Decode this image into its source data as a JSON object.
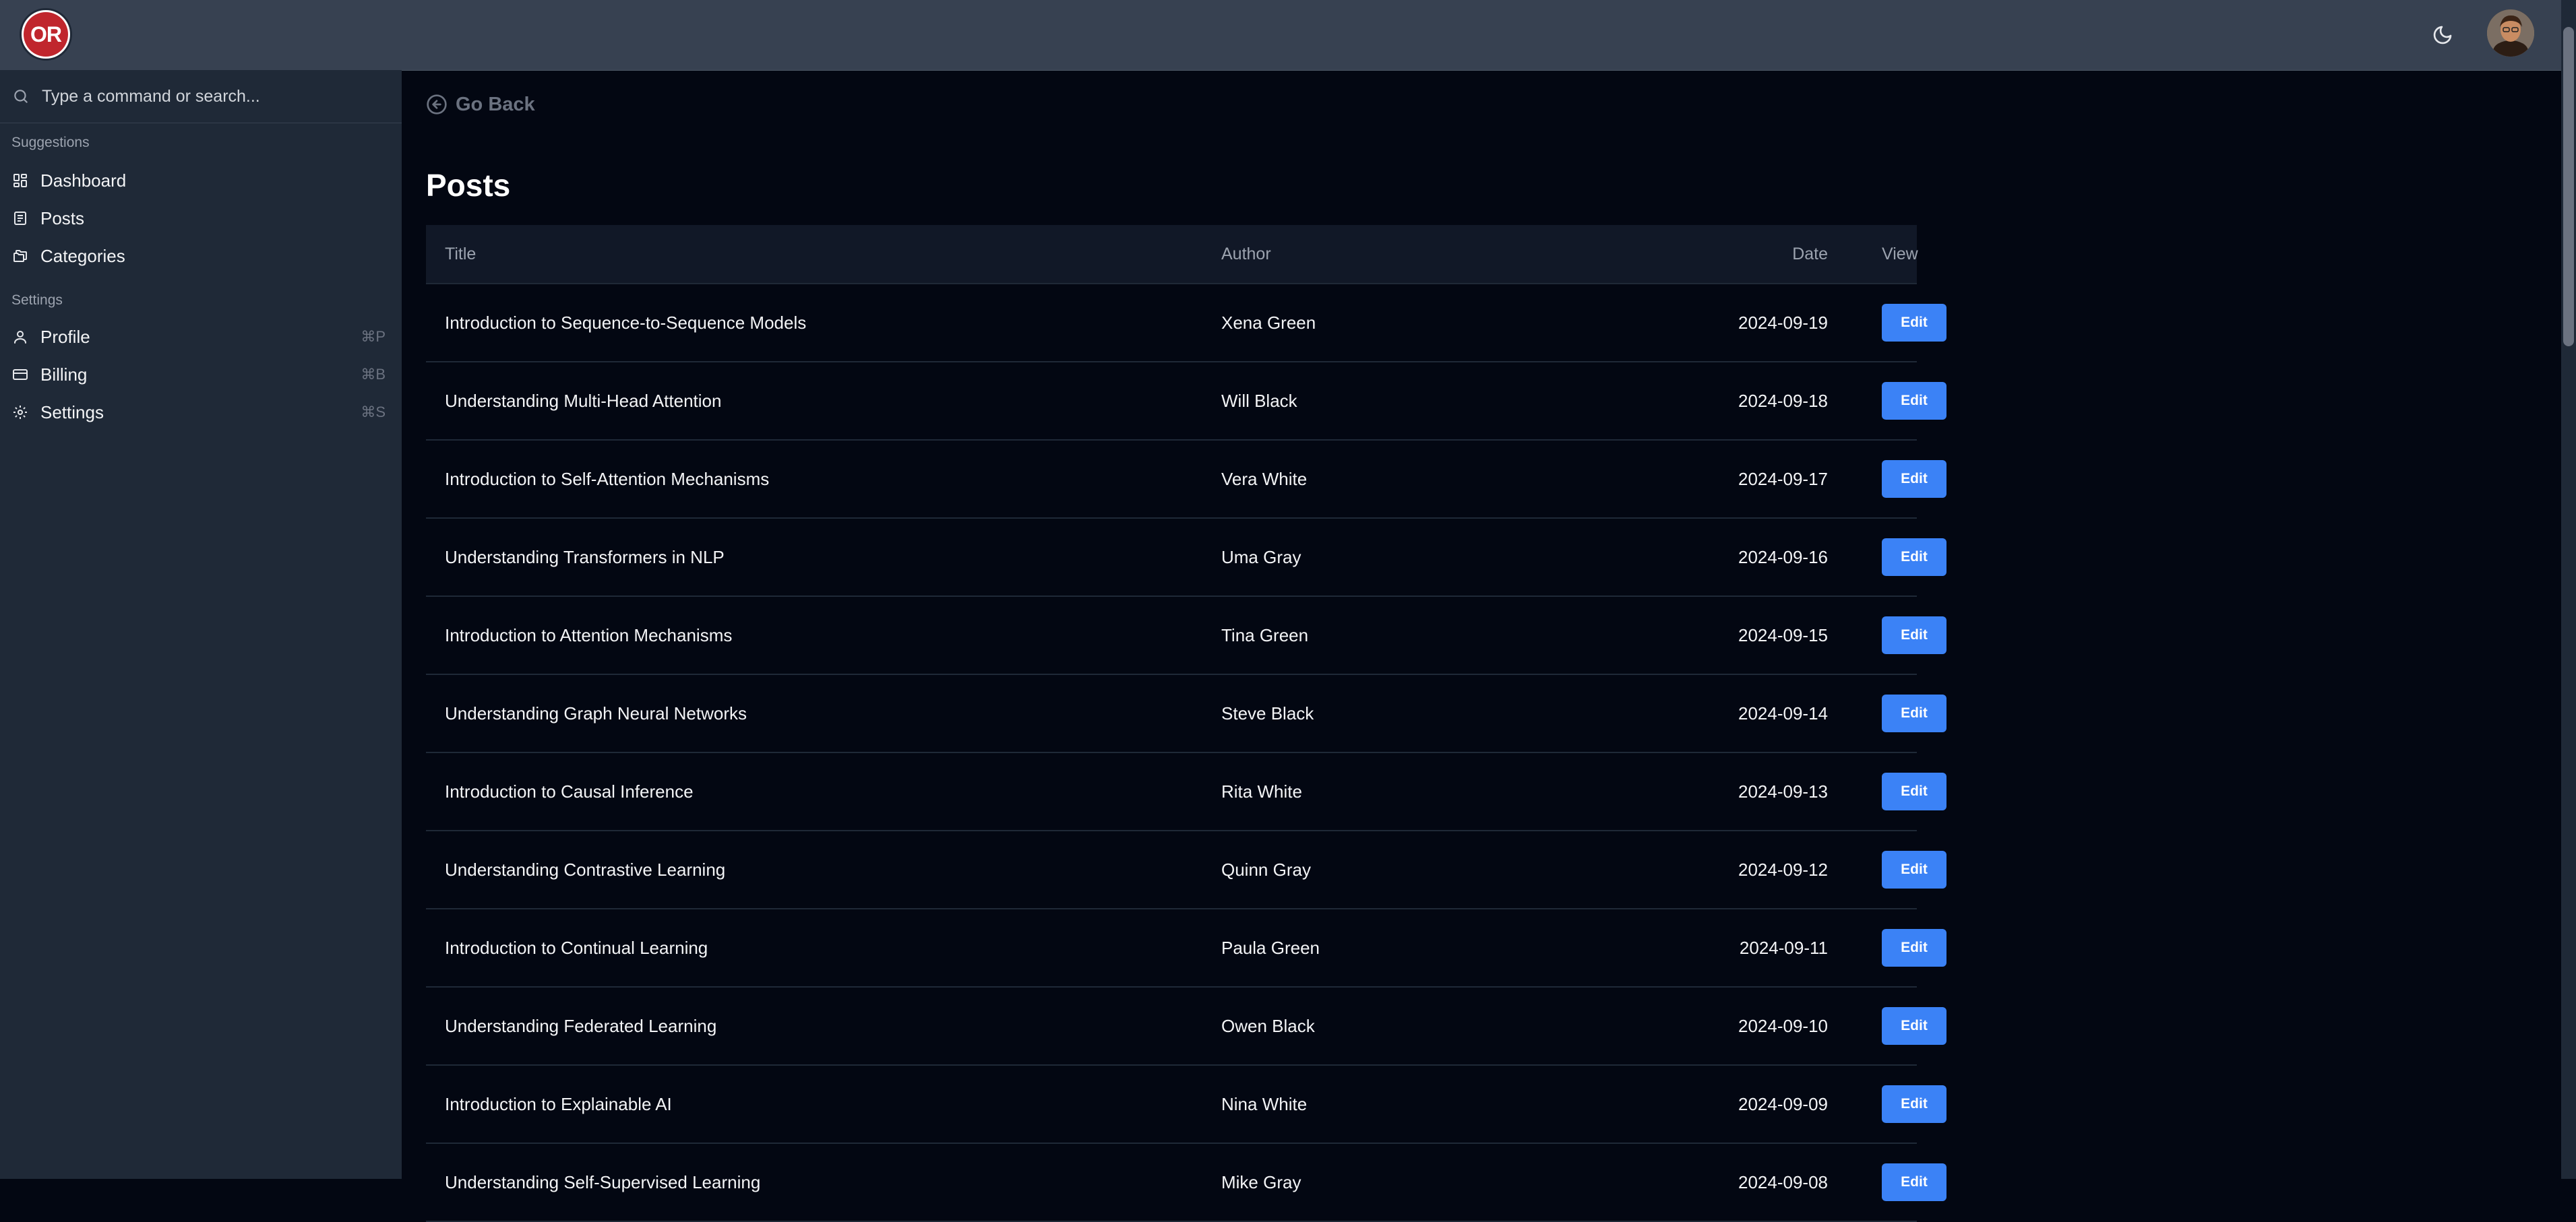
{
  "header": {
    "logo_text": "OR",
    "theme_icon": "moon-icon",
    "avatar_icon": "user-avatar"
  },
  "sidebar": {
    "search_placeholder": "Type a command or search...",
    "groups": [
      {
        "label": "Suggestions",
        "items": [
          {
            "label": "Dashboard",
            "icon": "dashboard-icon",
            "shortcut": ""
          },
          {
            "label": "Posts",
            "icon": "posts-icon",
            "shortcut": ""
          },
          {
            "label": "Categories",
            "icon": "folders-icon",
            "shortcut": ""
          }
        ]
      },
      {
        "label": "Settings",
        "items": [
          {
            "label": "Profile",
            "icon": "user-icon",
            "shortcut": "⌘P"
          },
          {
            "label": "Billing",
            "icon": "credit-card-icon",
            "shortcut": "⌘B"
          },
          {
            "label": "Settings",
            "icon": "gear-icon",
            "shortcut": "⌘S"
          }
        ]
      }
    ]
  },
  "main": {
    "go_back_label": "Go Back",
    "title": "Posts",
    "table": {
      "headers": {
        "title": "Title",
        "author": "Author",
        "date": "Date",
        "view": "View"
      },
      "edit_label": "Edit",
      "rows": [
        {
          "title": "Introduction to Sequence-to-Sequence Models",
          "author": "Xena Green",
          "date": "2024-09-19"
        },
        {
          "title": "Understanding Multi-Head Attention",
          "author": "Will Black",
          "date": "2024-09-18"
        },
        {
          "title": "Introduction to Self-Attention Mechanisms",
          "author": "Vera White",
          "date": "2024-09-17"
        },
        {
          "title": "Understanding Transformers in NLP",
          "author": "Uma Gray",
          "date": "2024-09-16"
        },
        {
          "title": "Introduction to Attention Mechanisms",
          "author": "Tina Green",
          "date": "2024-09-15"
        },
        {
          "title": "Understanding Graph Neural Networks",
          "author": "Steve Black",
          "date": "2024-09-14"
        },
        {
          "title": "Introduction to Causal Inference",
          "author": "Rita White",
          "date": "2024-09-13"
        },
        {
          "title": "Understanding Contrastive Learning",
          "author": "Quinn Gray",
          "date": "2024-09-12"
        },
        {
          "title": "Introduction to Continual Learning",
          "author": "Paula Green",
          "date": "2024-09-11"
        },
        {
          "title": "Understanding Federated Learning",
          "author": "Owen Black",
          "date": "2024-09-10"
        },
        {
          "title": "Introduction to Explainable AI",
          "author": "Nina White",
          "date": "2024-09-09"
        },
        {
          "title": "Understanding Self-Supervised Learning",
          "author": "Mike Gray",
          "date": "2024-09-08"
        }
      ]
    }
  },
  "colors": {
    "background": "#030712",
    "topbar": "#374151",
    "sidebar": "#1f2937",
    "accent": "#3b82f6"
  }
}
